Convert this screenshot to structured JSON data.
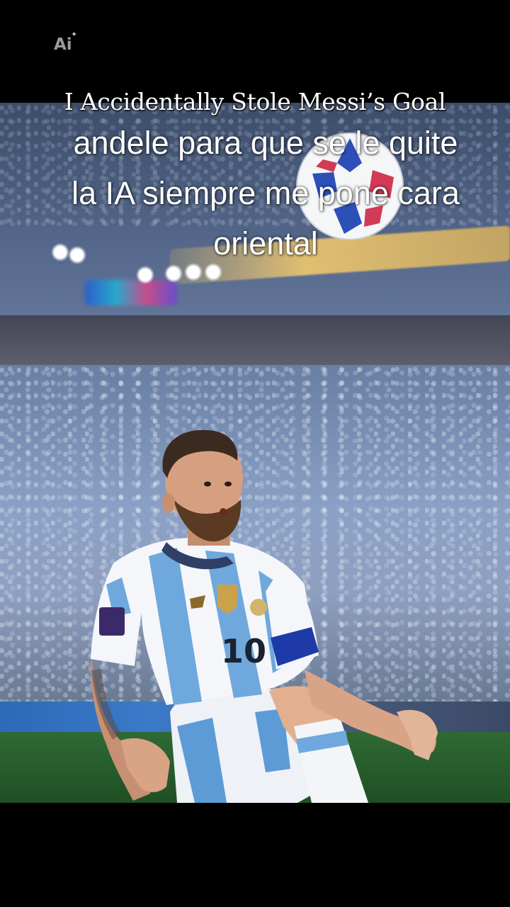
{
  "badge": {
    "label": "Ai",
    "spark": "✦"
  },
  "video": {
    "title": "I Accidentally Stole Messi’s Goal",
    "caption_lines": [
      "andele para que se le quite",
      "la IA siempre me pone cara",
      "oriental"
    ],
    "jersey_number": "10"
  },
  "colors": {
    "background": "#000000",
    "caption_text": "#ffffff",
    "jersey_blue": "#6fa8dc",
    "jersey_white": "#f4f6fa"
  }
}
